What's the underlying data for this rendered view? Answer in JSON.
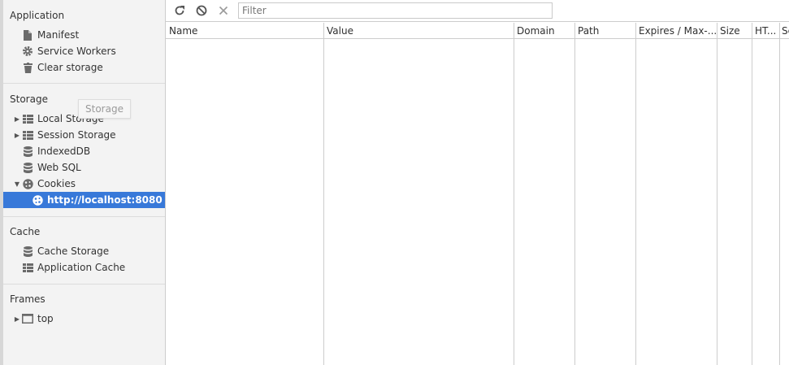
{
  "sidebar": {
    "application": {
      "title": "Application",
      "items": [
        {
          "label": "Manifest",
          "icon": "document-icon"
        },
        {
          "label": "Service Workers",
          "icon": "gear-icon"
        },
        {
          "label": "Clear storage",
          "icon": "trash-icon"
        }
      ]
    },
    "storage": {
      "title": "Storage",
      "items": [
        {
          "label": "Local Storage",
          "icon": "grid-icon",
          "expandable": true
        },
        {
          "label": "Session Storage",
          "icon": "grid-icon",
          "expandable": true
        },
        {
          "label": "IndexedDB",
          "icon": "database-icon"
        },
        {
          "label": "Web SQL",
          "icon": "database-icon"
        },
        {
          "label": "Cookies",
          "icon": "cookie-icon",
          "expanded": true
        },
        {
          "label": "http://localhost:8080",
          "icon": "cookie-icon",
          "selected": true
        }
      ]
    },
    "cache": {
      "title": "Cache",
      "items": [
        {
          "label": "Cache Storage",
          "icon": "database-icon"
        },
        {
          "label": "Application Cache",
          "icon": "grid-icon"
        }
      ]
    },
    "frames": {
      "title": "Frames",
      "items": [
        {
          "label": "top",
          "icon": "frame-icon",
          "expandable": true
        }
      ]
    },
    "tooltip": "Storage"
  },
  "toolbar": {
    "refresh_icon": "refresh-icon",
    "clear_all_icon": "block-icon",
    "delete_icon": "close-icon",
    "filter_placeholder": "Filter"
  },
  "table": {
    "columns": [
      "Name",
      "Value",
      "Domain",
      "Path",
      "Expires / Max-...",
      "Size",
      "HT...",
      "Se"
    ]
  },
  "colors": {
    "selection": "#3879d9",
    "sidebar_bg": "#f3f3f3",
    "border": "#cdcdcd"
  }
}
